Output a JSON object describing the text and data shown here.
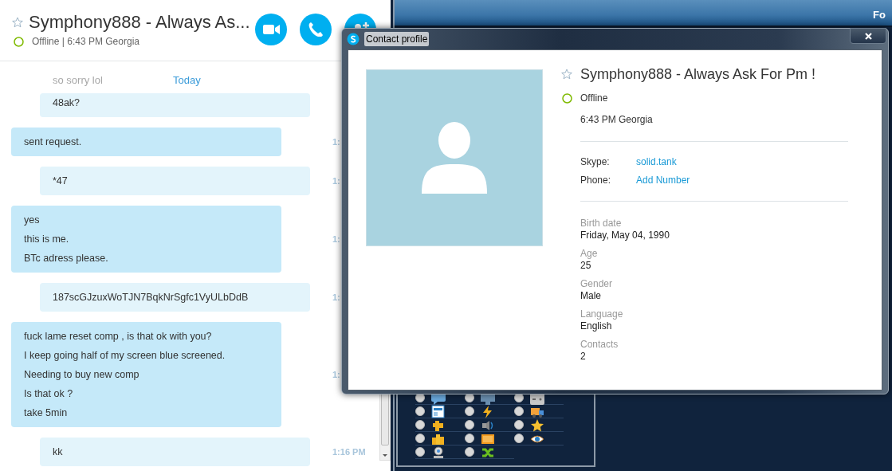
{
  "chat": {
    "title": "Symphony888 - Always As...",
    "status": "Offline | 6:43 PM Georgia",
    "online": false,
    "call_buttons": [
      {
        "kind": "video"
      },
      {
        "kind": "call"
      },
      {
        "kind": "add"
      }
    ],
    "faded_message": "so sorry lol",
    "date_divider": "Today",
    "messages": [
      {
        "kind": "outgoing",
        "lines": [
          "48ak?"
        ]
      },
      {
        "kind": "incoming",
        "lines": [
          "sent request."
        ],
        "time": "1:"
      },
      {
        "kind": "outgoing",
        "lines": [
          "*47"
        ],
        "time": "1:"
      },
      {
        "kind": "incoming",
        "lines": [
          "yes",
          "this is me.",
          "BTc adress please."
        ],
        "time": "1:"
      },
      {
        "kind": "outgoing",
        "lines": [
          "187scGJzuxWoTJN7BqkNrSgfc1VyULbDdB"
        ],
        "time": "1:"
      },
      {
        "kind": "incoming",
        "lines": [
          "fuck lame reset comp , is that ok with you?",
          "I keep going half of my screen blue screened.",
          "Needing to buy new comp",
          "Is that ok ?",
          "take 5min"
        ],
        "time": "1:"
      },
      {
        "kind": "outgoing",
        "lines": [
          "kk"
        ],
        "time": "1:16 PM"
      }
    ]
  },
  "background_window": {
    "header_text": "Fo",
    "options": [
      {
        "checked": false
      },
      {
        "checked": false
      },
      {
        "checked": false
      },
      {
        "checked": false
      },
      {
        "checked": false
      },
      {
        "checked": false
      },
      {
        "checked": false
      },
      {
        "checked": false
      },
      {
        "checked": false
      },
      {
        "checked": false
      },
      {
        "checked": false
      },
      {
        "checked": false
      },
      {
        "checked": false
      },
      {
        "checked": false
      }
    ]
  },
  "profile_dialog": {
    "title": "Contact profile",
    "name": "Symphony888 - Always Ask For Pm !",
    "status": "Offline",
    "online": false,
    "local_time": "6:43 PM Georgia",
    "contacts": [
      {
        "label": "Skype:",
        "value": "solid.tank"
      },
      {
        "label": "Phone:",
        "value": "Add Number"
      }
    ],
    "details": [
      {
        "label": "Birth date",
        "value": "Friday, May 04, 1990"
      },
      {
        "label": "Age",
        "value": "25"
      },
      {
        "label": "Gender",
        "value": "Male"
      },
      {
        "label": "Language",
        "value": "English"
      },
      {
        "label": "Contacts",
        "value": "2"
      }
    ]
  }
}
